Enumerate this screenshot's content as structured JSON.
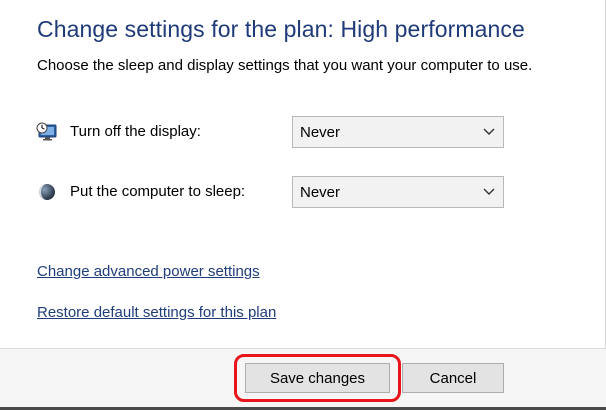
{
  "header": {
    "title": "Change settings for the plan: High performance",
    "subtitle": "Choose the sleep and display settings that you want your computer to use."
  },
  "settings": [
    {
      "label": "Turn off the display:",
      "icon": "display-icon",
      "value": "Never"
    },
    {
      "label": "Put the computer to sleep:",
      "icon": "moon-icon",
      "value": "Never"
    }
  ],
  "links": {
    "advanced": "Change advanced power settings",
    "restore": "Restore default settings for this plan"
  },
  "buttons": {
    "save_label": "Save changes",
    "cancel_label": "Cancel"
  },
  "colors": {
    "title": "#1e3a78",
    "link": "#1f3d7a",
    "highlight": "#e8151b"
  }
}
